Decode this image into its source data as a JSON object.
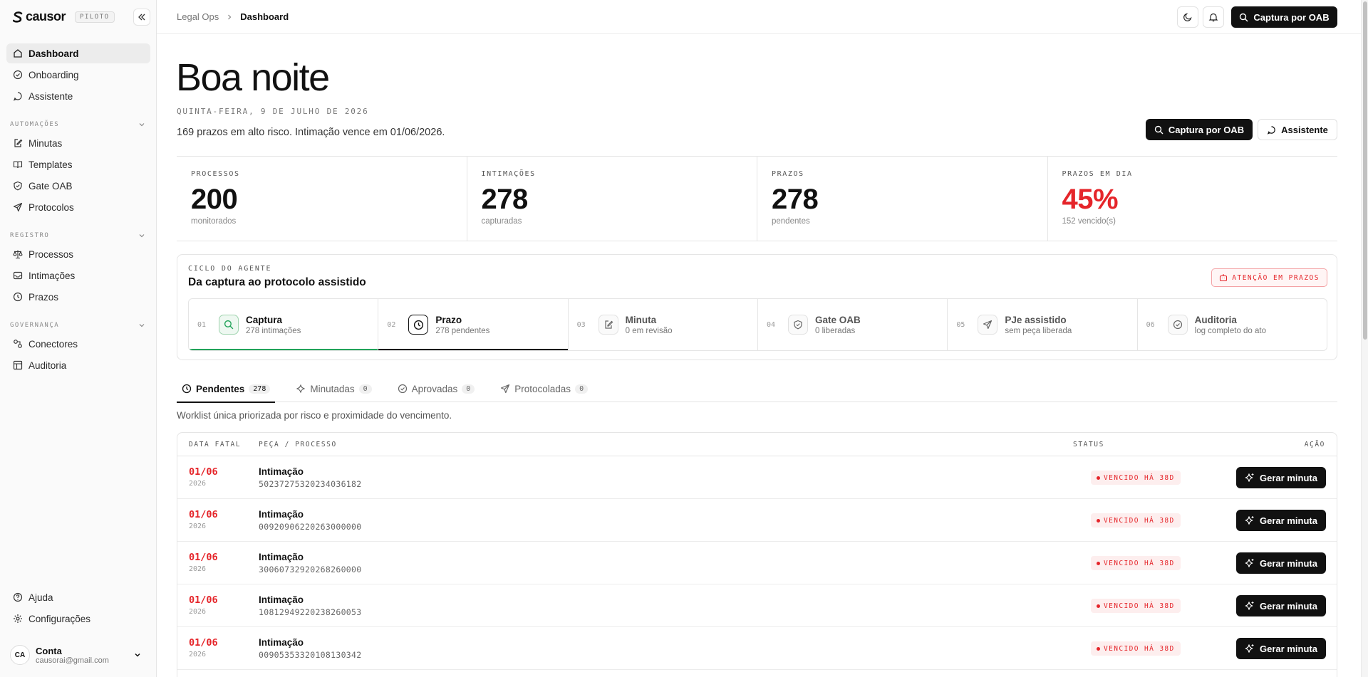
{
  "brand": {
    "name": "causor",
    "badge": "PILOTO"
  },
  "sidebar": {
    "top_items": [
      {
        "label": "Dashboard",
        "icon": "home-icon",
        "active": true
      },
      {
        "label": "Onboarding",
        "icon": "check-circle-icon"
      },
      {
        "label": "Assistente",
        "icon": "chat-icon"
      }
    ],
    "sections": [
      {
        "title": "AUTOMAÇÕES",
        "items": [
          {
            "label": "Minutas",
            "icon": "edit-icon"
          },
          {
            "label": "Templates",
            "icon": "book-icon"
          },
          {
            "label": "Gate OAB",
            "icon": "shield-icon"
          },
          {
            "label": "Protocolos",
            "icon": "send-icon"
          }
        ]
      },
      {
        "title": "REGISTRO",
        "items": [
          {
            "label": "Processos",
            "icon": "scale-icon"
          },
          {
            "label": "Intimações",
            "icon": "inbox-icon"
          },
          {
            "label": "Prazos",
            "icon": "clock-icon"
          }
        ]
      },
      {
        "title": "GOVERNANÇA",
        "items": [
          {
            "label": "Conectores",
            "icon": "connector-icon"
          },
          {
            "label": "Auditoria",
            "icon": "table-icon"
          }
        ]
      }
    ],
    "bottom_items": [
      {
        "label": "Ajuda",
        "icon": "help-icon"
      },
      {
        "label": "Configurações",
        "icon": "gear-icon"
      }
    ],
    "account": {
      "initials": "CA",
      "name": "Conta",
      "email": "causorai@gmail.com"
    }
  },
  "topbar": {
    "breadcrumb": [
      "Legal Ops",
      "Dashboard"
    ],
    "primary_button": "Captura por OAB"
  },
  "header": {
    "greeting": "Boa noite",
    "date": "QUINTA-FEIRA, 9 DE JULHO DE 2026",
    "summary": "169 prazos em alto risco. Intimação vence em 01/06/2026.",
    "capture_button": "Captura por OAB",
    "assistant_button": "Assistente"
  },
  "stats": [
    {
      "label": "PROCESSOS",
      "value": "200",
      "sub": "monitorados"
    },
    {
      "label": "INTIMAÇÕES",
      "value": "278",
      "sub": "capturadas"
    },
    {
      "label": "PRAZOS",
      "value": "278",
      "sub": "pendentes"
    },
    {
      "label": "PRAZOS EM DIA",
      "value": "45%",
      "sub": "152 vencido(s)",
      "alert": true
    }
  ],
  "cycle": {
    "kicker": "CICLO DO AGENTE",
    "title": "Da captura ao protocolo assistido",
    "alert": "ATENÇÃO EM PRAZOS",
    "steps": [
      {
        "num": "01",
        "title": "Captura",
        "sub": "278 intimações",
        "icon": "search-icon",
        "state": "done"
      },
      {
        "num": "02",
        "title": "Prazo",
        "sub": "278 pendentes",
        "icon": "clock-icon",
        "state": "current"
      },
      {
        "num": "03",
        "title": "Minuta",
        "sub": "0 em revisão",
        "icon": "edit-icon",
        "state": "pending"
      },
      {
        "num": "04",
        "title": "Gate OAB",
        "sub": "0 liberadas",
        "icon": "shield-icon",
        "state": "pending"
      },
      {
        "num": "05",
        "title": "PJe assistido",
        "sub": "sem peça liberada",
        "icon": "send-icon",
        "state": "pending"
      },
      {
        "num": "06",
        "title": "Auditoria",
        "sub": "log completo do ato",
        "icon": "check-circle-icon",
        "state": "pending"
      }
    ]
  },
  "tabs": [
    {
      "label": "Pendentes",
      "count": "278",
      "icon": "clock-icon",
      "active": true
    },
    {
      "label": "Minutadas",
      "count": "0",
      "icon": "sparkle-icon"
    },
    {
      "label": "Aprovadas",
      "count": "0",
      "icon": "check-circle-icon"
    },
    {
      "label": "Protocoladas",
      "count": "0",
      "icon": "send-icon"
    }
  ],
  "worklist_description": "Worklist única priorizada por risco e proximidade do vencimento.",
  "table": {
    "headers": {
      "date": "DATA FATAL",
      "piece": "PEÇA / PROCESSO",
      "status": "STATUS",
      "action": "AÇÃO"
    },
    "rows": [
      {
        "day": "01/06",
        "year": "2026",
        "title": "Intimação",
        "process": "50237275320234036182",
        "status": "VENCIDO HÁ 38D",
        "action": "Gerar minuta"
      },
      {
        "day": "01/06",
        "year": "2026",
        "title": "Intimação",
        "process": "00920906220263000000",
        "status": "VENCIDO HÁ 38D",
        "action": "Gerar minuta"
      },
      {
        "day": "01/06",
        "year": "2026",
        "title": "Intimação",
        "process": "30060732920268260000",
        "status": "VENCIDO HÁ 38D",
        "action": "Gerar minuta"
      },
      {
        "day": "01/06",
        "year": "2026",
        "title": "Intimação",
        "process": "10812949220238260053",
        "status": "VENCIDO HÁ 38D",
        "action": "Gerar minuta"
      },
      {
        "day": "01/06",
        "year": "2026",
        "title": "Intimação",
        "process": "00905353320108130342",
        "status": "VENCIDO HÁ 38D",
        "action": "Gerar minuta"
      }
    ]
  },
  "colors": {
    "accent_red": "#e5252a",
    "success_green": "#22a35a",
    "dark": "#111111"
  }
}
